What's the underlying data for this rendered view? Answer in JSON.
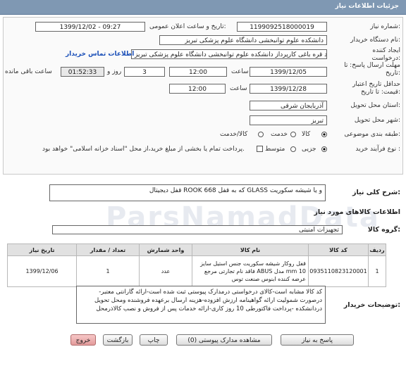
{
  "header": {
    "title": "جزئیات اطلاعات نیاز"
  },
  "fields": {
    "need_number_label": "شماره نیاز:",
    "need_number": "1199092518000019",
    "announce_label": "تاریخ و ساعت اعلان عمومی:",
    "announce_value": "1399/12/02 - 09:27",
    "buyer_org_label": "نام دستگاه خریدار:",
    "buyer_org": "دانشکده علوم توانبخشی دانشگاه علوم پزشکی تبریز",
    "creator_label": "ایجاد کننده درخواست:",
    "creator": "مهرداد قره باغی کارپرداز دانشکده علوم توانبخشی دانشگاه علوم پزشکی تبریز",
    "contact_link": "اطلاعات تماس خریدار",
    "send_deadline_label": "مهلت ارسال پاسخ: تا تاریخ:",
    "send_date": "1399/12/05",
    "time_label": "ساعت",
    "send_time": "12:00",
    "days_value": "3",
    "days_and_label": "روز و",
    "remaining_time": "01:52:33",
    "remaining_label": "ساعت باقی مانده",
    "validity_label": "حداقل تاریخ اعتبار قیمت: تا تاریخ:",
    "validity_date": "1399/12/28",
    "validity_time": "12:00",
    "province_label": "استان محل تحویل:",
    "province": "آذربایجان شرقی",
    "city_label": "شهر محل تحویل:",
    "city": "تبریز",
    "category_label": "طبقه بندی موضوعی:",
    "category_options": [
      "کالا",
      "خدمت",
      "کالا/خدمت"
    ],
    "process_label": "نوع فرآیند خرید :",
    "process_options": [
      "جزیی",
      "متوسط"
    ],
    "payment_note": "پرداخت تمام یا بخشی از مبلغ خرید،از محل \"اسناد خزانه اسلامی\" خواهد بود."
  },
  "summary": {
    "label": "شرح کلی نیاز:",
    "text": "قفل دیجیتال ROOK 668 که به قفل GLASS و یا شیشه سکوریت"
  },
  "goods": {
    "section_title": "اطلاعات کالاهای مورد نیاز",
    "group_label": "گروه کالا:",
    "group_value": "تجهیزات امنیتی",
    "columns": [
      "ردیف",
      "کد کالا",
      "نام کالا",
      "واحد شمارش",
      "تعداد / مقدار",
      "تاریخ نیاز"
    ],
    "rows": [
      {
        "row": "1",
        "code": "0935110823120001",
        "name": "قفل روکار شیشه سکوریت جنس استیل سایز mm 10 مدل ABUS فاقد نام تجارتی مرجع عرضه کننده ابنوس صنعت توس",
        "unit": "عدد",
        "qty": "1",
        "date": "1399/12/06"
      }
    ]
  },
  "notes": {
    "label": "توضیحات خریدار:",
    "text": "کد کالا مشابه است-کالای درخواستی درمدارک پیوستی ثبت شده است-ارائه گارانتی معتبر-درصورت شمولیت ارائه گواهینامه ارزش افزوده-هزینه ارسال برعهده فروشنده ومحل تحویل دردانشکده -پرداخت فاکتورطی 10 روز کاری-ارائه خدمات پس از فروش و نصب کالاذرمحل"
  },
  "buttons": {
    "reply": "پاسخ به نیاز",
    "attachments": "مشاهده مدارک پیوستی (0)",
    "print": "چاپ",
    "back": "بازگشت",
    "exit": "خروج"
  },
  "watermark": "ParsNamadData"
}
